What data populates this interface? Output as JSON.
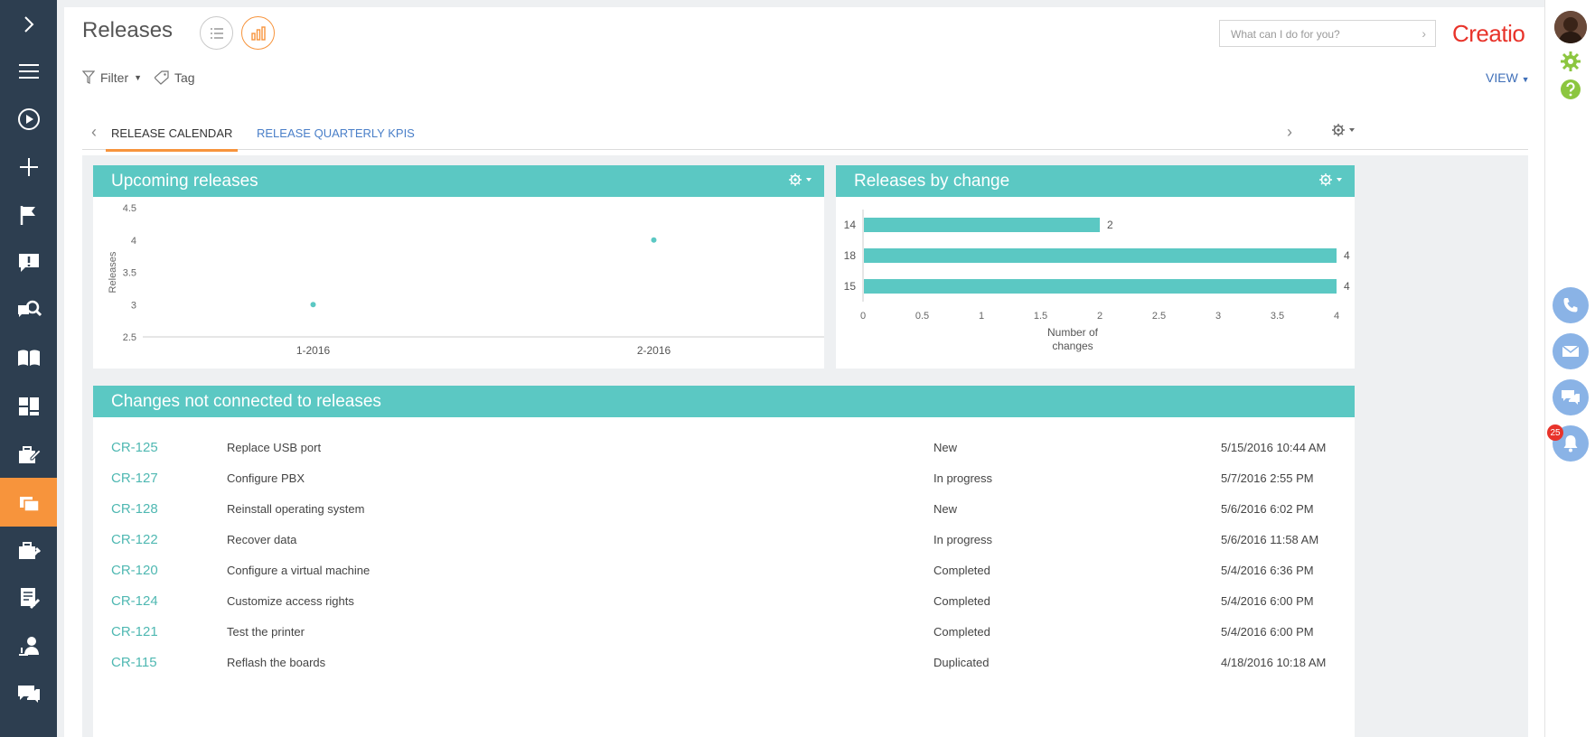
{
  "app": {
    "page_title": "Releases",
    "search_placeholder": "What can I do for you?",
    "logo_text": "Creatio",
    "accent_color": "#f7943c",
    "panel_color": "#5bc8c3",
    "sidebar_color": "#2d3e50"
  },
  "sidebar": {
    "items": [
      {
        "icon": "chevron-right-icon"
      },
      {
        "icon": "menu-icon"
      },
      {
        "icon": "play-icon"
      },
      {
        "icon": "plus-icon"
      },
      {
        "icon": "flag-icon"
      },
      {
        "icon": "alert-icon"
      },
      {
        "icon": "knowledge-search-icon"
      },
      {
        "icon": "book-icon"
      },
      {
        "icon": "dashboard-icon"
      },
      {
        "icon": "edit-case-icon"
      },
      {
        "icon": "releases-icon",
        "active": true
      },
      {
        "icon": "tools-case-icon"
      },
      {
        "icon": "document-tools-icon"
      },
      {
        "icon": "user-tools-icon"
      },
      {
        "icon": "chat-icon"
      }
    ]
  },
  "toolbar": {
    "filter_label": "Filter",
    "tag_label": "Tag",
    "view_label": "VIEW"
  },
  "tabs": [
    {
      "label": "RELEASE CALENDAR",
      "active": true
    },
    {
      "label": "RELEASE QUARTERLY KPIS",
      "active": false
    }
  ],
  "upcoming": {
    "title": "Upcoming releases"
  },
  "by_change": {
    "title": "Releases by change"
  },
  "chart_data": [
    {
      "type": "scatter",
      "title": "Upcoming releases",
      "ylabel": "Releases",
      "xlabel": "",
      "categories": [
        "1-2016",
        "2-2016"
      ],
      "values": [
        3,
        4
      ],
      "ylim": [
        2.5,
        4.5
      ],
      "yticks": [
        "4.5",
        "4",
        "3.5",
        "3",
        "2.5"
      ],
      "color": "#5bc8c3"
    },
    {
      "type": "bar",
      "title": "Releases by change",
      "xlabel": "Number of changes",
      "ylabel": "",
      "categories": [
        "14",
        "18",
        "15"
      ],
      "values": [
        2,
        4,
        4
      ],
      "xlim": [
        0,
        4
      ],
      "xticks": [
        "0",
        "0.5",
        "1",
        "1.5",
        "2",
        "2.5",
        "3",
        "3.5",
        "4"
      ],
      "color": "#5bc8c3"
    }
  ],
  "changes": {
    "title": "Changes not connected to releases",
    "rows": [
      {
        "code": "CR-125",
        "name": "Replace USB port",
        "status": "New",
        "date": "5/15/2016 10:44 AM"
      },
      {
        "code": "CR-127",
        "name": "Configure PBX",
        "status": "In progress",
        "date": "5/7/2016 2:55 PM"
      },
      {
        "code": "CR-128",
        "name": "Reinstall operating system",
        "status": "New",
        "date": "5/6/2016 6:02 PM"
      },
      {
        "code": "CR-122",
        "name": "Recover data",
        "status": "In progress",
        "date": "5/6/2016 11:58 AM"
      },
      {
        "code": "CR-120",
        "name": "Configure a virtual machine",
        "status": "Completed",
        "date": "5/4/2016 6:36 PM"
      },
      {
        "code": "CR-124",
        "name": "Customize access rights",
        "status": "Completed",
        "date": "5/4/2016 6:00 PM"
      },
      {
        "code": "CR-121",
        "name": "Test the printer",
        "status": "Completed",
        "date": "5/4/2016 6:00 PM"
      },
      {
        "code": "CR-115",
        "name": "Reflash the boards",
        "status": "Duplicated",
        "date": "4/18/2016 10:18 AM"
      }
    ]
  },
  "rail": {
    "notification_count": "25"
  }
}
